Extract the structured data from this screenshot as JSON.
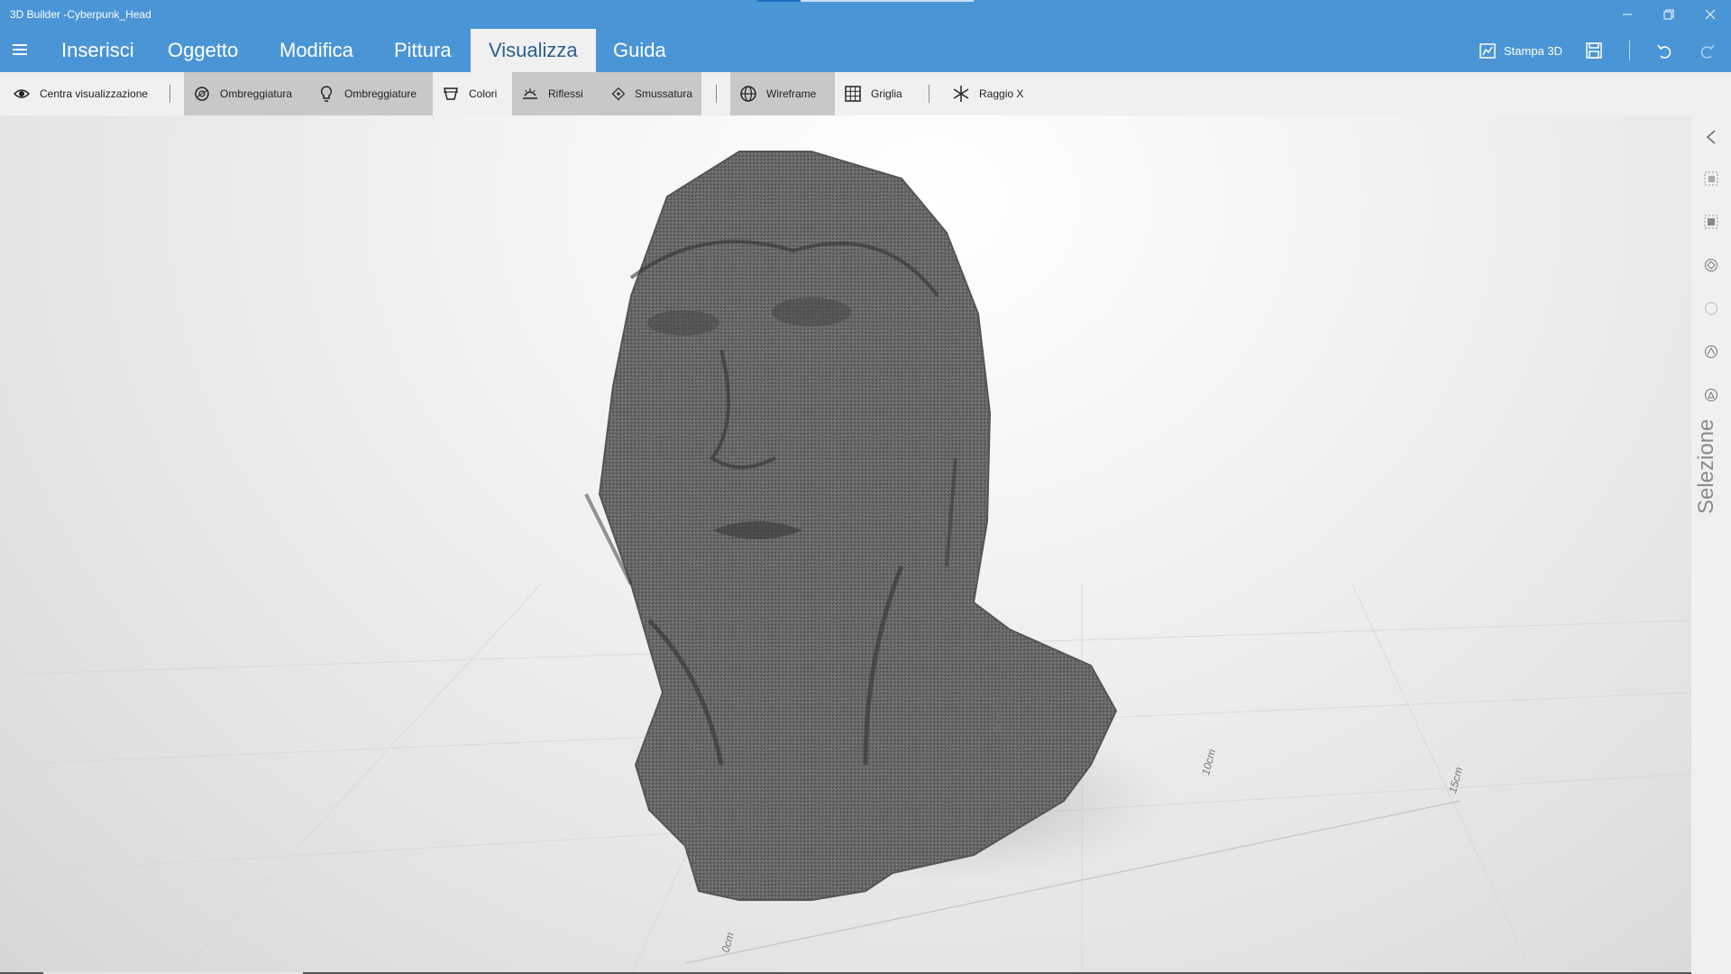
{
  "window": {
    "title": "3D Builder -Cyberpunk_Head",
    "accent": "#4a95d5"
  },
  "ribbon": {
    "tabs": [
      {
        "label": "Inserisci"
      },
      {
        "label": "Oggetto"
      },
      {
        "label": "Modifica"
      },
      {
        "label": "Pittura"
      },
      {
        "label": "Visualizza"
      },
      {
        "label": "Guida"
      }
    ],
    "active_tab": "Visualizza",
    "print_label": "Stampa 3D"
  },
  "toolbar": {
    "center_view": "Centra visualizzazione",
    "shading": "Ombreggiatura",
    "shadows": "Ombreggiature",
    "colors": "Colori",
    "reflections": "Riflessi",
    "smoothing": "Smussatura",
    "wireframe": "Wireframe",
    "grid": "Griglia",
    "xray": "Raggio X"
  },
  "sidepanel": {
    "label": "Selezione"
  },
  "ruler": {
    "marks": [
      "5cm",
      "10cm",
      "15cm",
      "0cm"
    ]
  }
}
